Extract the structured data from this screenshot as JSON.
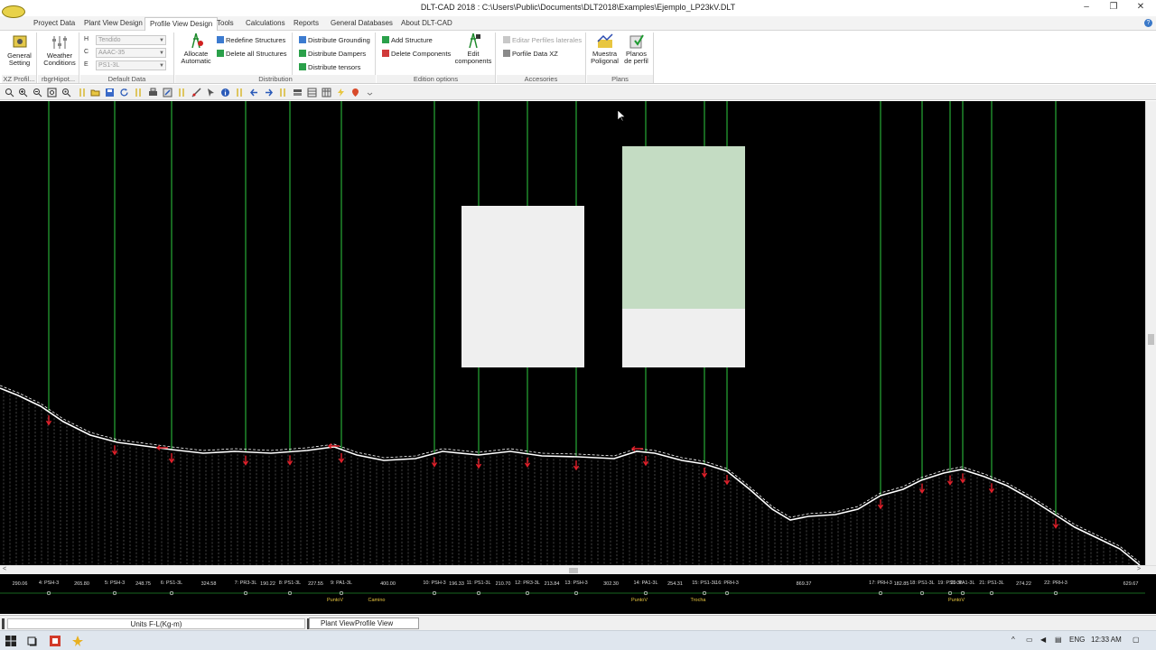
{
  "window": {
    "title": "DLT-CAD 2018 : C:\\Users\\Public\\Documents\\DLT2018\\Examples\\Ejemplo_LP23kV.DLT",
    "minimize": "–",
    "restore": "❐",
    "close": "✕"
  },
  "menu": {
    "items": [
      "Proyect Data",
      "Plant View Design",
      "Profile View Design",
      "Tools",
      "Calculations",
      "Reports",
      "General Databases",
      "About DLT-CAD"
    ],
    "active": "Profile View Design",
    "help": "?"
  },
  "ribbon": {
    "g1": {
      "btn1": "General",
      "btn1b": "Setting",
      "label": "XZ Profil..."
    },
    "g2": {
      "btn1": "Weather",
      "btn1b": "Conditions",
      "label": "rbgrHipot..."
    },
    "default_data": {
      "label": "Default Data",
      "rows": [
        {
          "key": "H",
          "value": "Tendido"
        },
        {
          "key": "C",
          "value": "AAAC-35"
        },
        {
          "key": "E",
          "value": "PS1-3L"
        }
      ]
    },
    "distribution": {
      "label": "Distribution",
      "allocate1": "Allocate",
      "allocate2": "Automatic",
      "redefine": "Redefine Structures",
      "delete_all": "Delete all Structures",
      "grounding": "Distribute Grounding",
      "dampers": "Distribute Dampers",
      "tensors": "Distribute tensors"
    },
    "edition": {
      "label": "Edition options",
      "add": "Add Structure",
      "delete": "Delete Components",
      "edit1": "Edit",
      "edit2": "components"
    },
    "accesories": {
      "label": "Accesories",
      "editar": "Editar Perfiles laterales",
      "porfile": "Porfile Data XZ"
    },
    "plans": {
      "label": "Plans",
      "muestra1": "Muestra",
      "muestra2": "Poligonal",
      "planos1": "Planos",
      "planos2": "de perfil"
    }
  },
  "profile": {
    "stations": [
      {
        "name": "4: PSH-3",
        "span_before": "290.06",
        "note": ""
      },
      {
        "name": "5: PSH-3",
        "span_before": "265.80",
        "note": ""
      },
      {
        "name": "6: PS1-3L",
        "span_before": "248.75",
        "note": ""
      },
      {
        "name": "7: PR3-3L",
        "span_before": "324.58",
        "note": ""
      },
      {
        "name": "8: PS1-3L",
        "span_before": "190.22",
        "note": ""
      },
      {
        "name": "9: PA1-3L",
        "span_before": "227.55",
        "note": "PuntoV"
      },
      {
        "name": "10: PSH-3",
        "span_before": "400.00",
        "note": "Camino"
      },
      {
        "name": "11: PS1-3L",
        "span_before": "196.33",
        "note": ""
      },
      {
        "name": "12: PR3-3L",
        "span_before": "210.70",
        "note": ""
      },
      {
        "name": "13: PSH-3",
        "span_before": "213.84",
        "note": ""
      },
      {
        "name": "14: PA1-3L",
        "span_before": "302.30",
        "note": "PuntoV"
      },
      {
        "name": "15: PS1-3L",
        "span_before": "254.31",
        "note": "Trocha"
      },
      {
        "name": "16: PRH-3",
        "span_before": "",
        "note": ""
      },
      {
        "name": "17: PRH-3",
        "span_before": "869.37",
        "note": ""
      },
      {
        "name": "18: PS1-3L",
        "span_before": "182.85",
        "note": ""
      },
      {
        "name": "19: PS1-3L",
        "span_before": "",
        "note": ""
      },
      {
        "name": "20: PA1-3L",
        "span_before": "",
        "note": "PuntoV"
      },
      {
        "name": "21: PS1-3L",
        "span_before": "",
        "note": ""
      },
      {
        "name": "22: PRH-3",
        "span_before": "274.22",
        "note": ""
      }
    ],
    "span_after_last": "629.67",
    "colors": {
      "structure": "#2ecc40",
      "ground": "#ffffff",
      "marker": "#e0202a"
    }
  },
  "overlay_panels": [
    "blank-panel-left",
    "blank-panel-right"
  ],
  "status": {
    "units": "Units F-L(Kg-m)",
    "tab_plant": "Plant View",
    "tab_profile": "Profile View"
  },
  "taskbar": {
    "lang": "ENG",
    "time": "12:33 AM"
  }
}
